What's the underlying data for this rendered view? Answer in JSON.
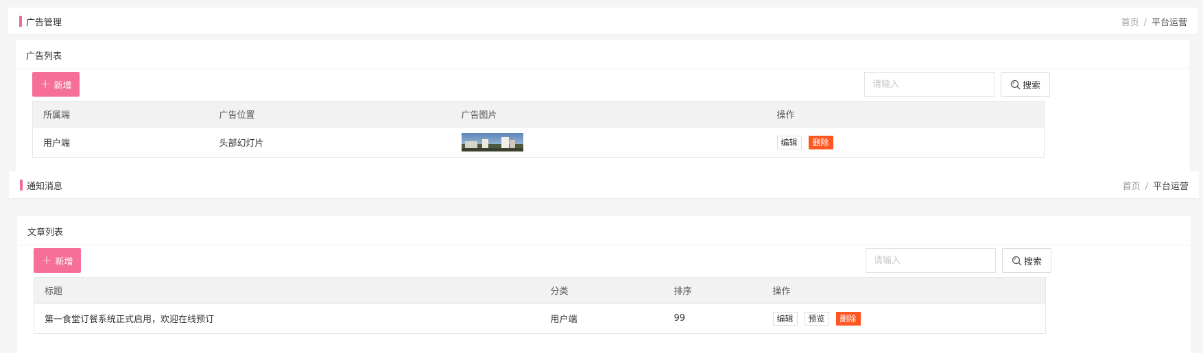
{
  "ad_panel": {
    "header": {
      "title": "广告管理",
      "breadcrumb": [
        "首页",
        "平台运营"
      ]
    },
    "card": {
      "title": "广告列表",
      "add_label": "新增",
      "search": {
        "placeholder": "请输入",
        "value": "",
        "button_label": "搜索"
      },
      "columns": [
        "所属端",
        "广告位置",
        "广告图片",
        "操作"
      ],
      "rows": [
        {
          "client": "用户端",
          "position": "头部幻灯片",
          "image_icon": "building-photo",
          "actions": [
            "编辑",
            "删除"
          ]
        }
      ]
    }
  },
  "notice_panel": {
    "header": {
      "title": "通知消息",
      "breadcrumb": [
        "首页",
        "平台运营"
      ]
    },
    "card": {
      "title": "文章列表",
      "add_label": "新增",
      "search": {
        "placeholder": "请输入",
        "value": "",
        "button_label": "搜索"
      },
      "columns": [
        "标题",
        "分类",
        "排序",
        "操作"
      ],
      "rows": [
        {
          "title": "第一食堂订餐系统正式启用，欢迎在线预订",
          "category": "用户端",
          "order": "99",
          "actions": [
            "编辑",
            "预览",
            "删除"
          ]
        }
      ]
    }
  },
  "colors": {
    "accent": "#f56f98",
    "header_bar": "#f06b91",
    "danger": "#ff5722",
    "table_header_bg": "#f2f2f2",
    "page_bg": "#f5f5f5"
  },
  "icons": {
    "search": "search-icon",
    "add": "plus-icon"
  }
}
